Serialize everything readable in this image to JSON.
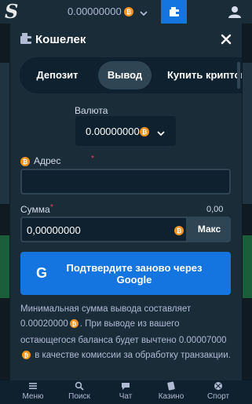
{
  "topbar": {
    "logo": "S",
    "balance": "0.00000000",
    "currency_icon": "bitcoin-icon"
  },
  "modal": {
    "title": "Кошелек",
    "tabs": [
      "Депозит",
      "Вывод",
      "Купить криптовал"
    ],
    "active_tab": "Вывод",
    "currency": {
      "label": "Валюта",
      "value": "0.00000000"
    },
    "address": {
      "label": "Адрес",
      "required": "*",
      "value": ""
    },
    "amount": {
      "label": "Сумма",
      "required": "*",
      "available": "0,00",
      "value": "0,00000000",
      "max_label": "Макс"
    },
    "google_button": {
      "icon": "G",
      "label": "Подтвердите заново через Google"
    },
    "note": {
      "part1": "Минимальная сумма вывода составляет",
      "min_amount": "0.00020000",
      "part2": ". При выводе из вашего остающегося баланса будет вычтено",
      "fee_amount": "0.00007000",
      "part3": "в качестве комиссии за обработку транзакции."
    }
  },
  "bottom_nav": {
    "items": [
      {
        "label": "Меню",
        "icon": "menu-icon"
      },
      {
        "label": "Поиск",
        "icon": "search-icon"
      },
      {
        "label": "Чат",
        "icon": "chat-icon"
      },
      {
        "label": "Казино",
        "icon": "casino-icon"
      },
      {
        "label": "Спорт",
        "icon": "sport-icon"
      }
    ]
  },
  "colors": {
    "accent": "#1475e1",
    "bitcoin": "#f7931a",
    "required": "#ed4163"
  }
}
